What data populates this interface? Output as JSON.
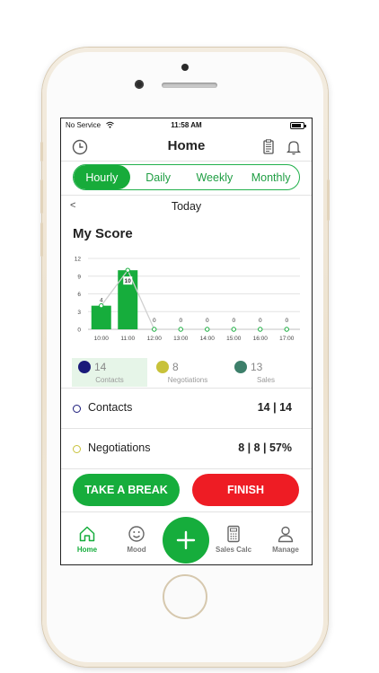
{
  "status_bar": {
    "carrier": "No Service",
    "time": "11:58 AM"
  },
  "header": {
    "title": "Home"
  },
  "range_tabs": [
    {
      "label": "Hourly",
      "active": true
    },
    {
      "label": "Daily",
      "active": false
    },
    {
      "label": "Weekly",
      "active": false
    },
    {
      "label": "Monthly",
      "active": false
    }
  ],
  "date_nav": {
    "back": "<",
    "label": "Today"
  },
  "score": {
    "title": "My Score"
  },
  "chart_data": {
    "type": "bar",
    "categories": [
      "10:00",
      "11:00",
      "12:00",
      "13:00",
      "14:00",
      "15:00",
      "16:00",
      "17:00"
    ],
    "values": [
      4,
      10,
      0,
      0,
      0,
      0,
      0,
      0
    ],
    "data_labels": [
      "4",
      "10",
      "0",
      "0",
      "0",
      "0",
      "0",
      "0"
    ],
    "line_values": [
      4,
      10,
      0,
      0,
      0,
      0,
      0,
      0
    ],
    "y_ticks": [
      "12",
      "9",
      "6",
      "3",
      "0"
    ],
    "ylim": [
      0,
      12
    ],
    "grid": true,
    "bar_color": "#16ad3c",
    "line_color": "#d0d0d0"
  },
  "legend": [
    {
      "value": "14",
      "label": "Contacts",
      "color": "#1a1a7a",
      "active": true
    },
    {
      "value": "8",
      "label": "Negotiations",
      "color": "#c8c23a",
      "active": false
    },
    {
      "value": "13",
      "label": "Sales",
      "color": "#3d7f6a",
      "active": false
    }
  ],
  "metrics": [
    {
      "name": "Contacts",
      "value": "14 | 14",
      "color": "#1a1a7a"
    },
    {
      "name": "Negotiations",
      "value": "8 | 8 | 57%",
      "color": "#c8c23a"
    }
  ],
  "actions": {
    "break_label": "TAKE A BREAK",
    "finish_label": "FINISH"
  },
  "tabbar": {
    "items": [
      {
        "label": "Home",
        "icon": "home-icon",
        "active": true
      },
      {
        "label": "Mood",
        "icon": "smiley-icon",
        "active": false
      },
      {
        "label": "Sales Calc",
        "icon": "calculator-icon",
        "active": false
      },
      {
        "label": "Manage",
        "icon": "person-icon",
        "active": false
      }
    ]
  },
  "colors": {
    "accent": "#16ad3c",
    "danger": "#ee1c24",
    "text": "#222222"
  }
}
